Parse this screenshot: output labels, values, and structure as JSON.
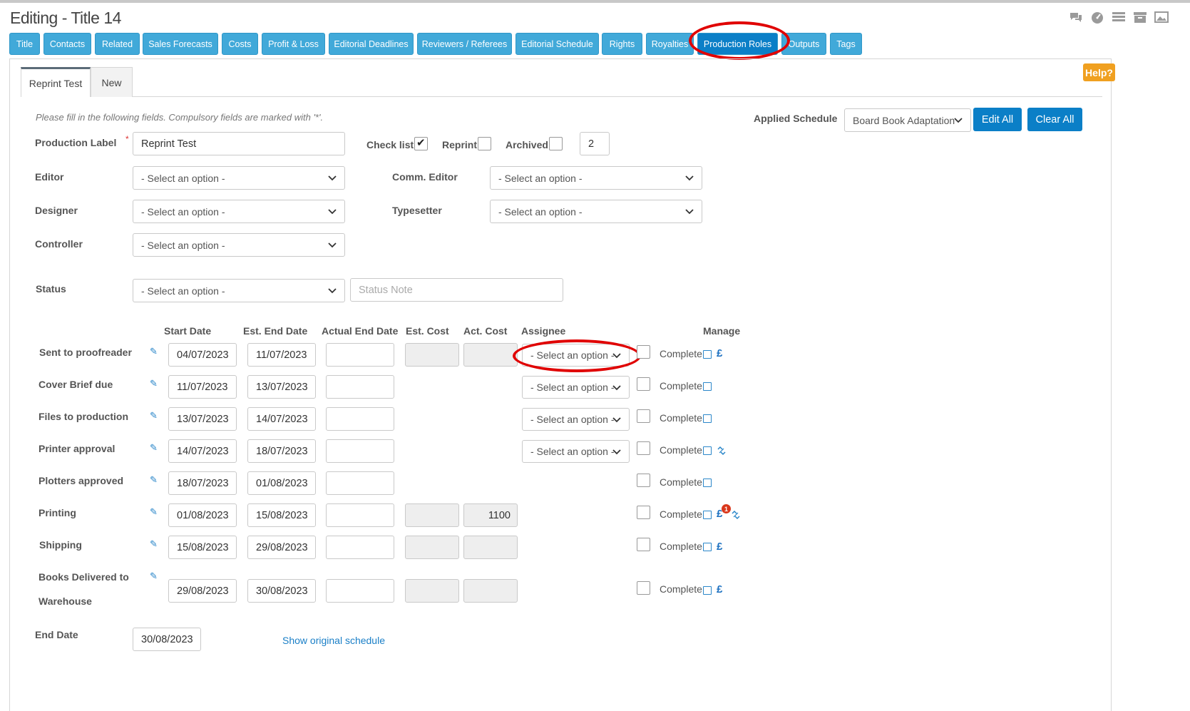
{
  "window": {
    "title": "Editing - Title 14"
  },
  "top_icons": [
    "comments-icon",
    "dashboard-icon",
    "list-icon",
    "archive-icon",
    "image-icon"
  ],
  "tabs": [
    {
      "label": "Title",
      "active": false
    },
    {
      "label": "Contacts",
      "active": false
    },
    {
      "label": "Related",
      "active": false
    },
    {
      "label": "Sales Forecasts",
      "active": false
    },
    {
      "label": "Costs",
      "active": false
    },
    {
      "label": "Profit & Loss",
      "active": false
    },
    {
      "label": "Editorial Deadlines",
      "active": false
    },
    {
      "label": "Reviewers / Referees",
      "active": false
    },
    {
      "label": "Editorial Schedule",
      "active": false
    },
    {
      "label": "Rights",
      "active": false
    },
    {
      "label": "Royalties",
      "active": false
    },
    {
      "label": "Production Roles",
      "active": true
    },
    {
      "label": "Outputs",
      "active": false
    },
    {
      "label": "Tags",
      "active": false
    }
  ],
  "help_label": "Help?",
  "subtabs": [
    {
      "label": "Reprint Test",
      "active": true
    },
    {
      "label": "New",
      "active": false
    }
  ],
  "form": {
    "hint": "Please fill in the following fields. Compulsory fields are marked with '*'.",
    "required_mark": "*",
    "production_label": {
      "label": "Production Label",
      "value": "Reprint Test"
    },
    "check_list": {
      "label": "Check list",
      "checked": true
    },
    "reprint": {
      "label": "Reprint",
      "checked": false
    },
    "archived": {
      "label": "Archived",
      "checked": false
    },
    "number_value": "2",
    "applied_schedule": {
      "label": "Applied Schedule",
      "value": "Board Book Adaptation"
    },
    "edit_all_label": "Edit All",
    "clear_all_label": "Clear All",
    "editor": {
      "label": "Editor",
      "value": "- Select an option -"
    },
    "comm_editor": {
      "label": "Comm. Editor",
      "value": "- Select an option -"
    },
    "designer": {
      "label": "Designer",
      "value": "- Select an option -"
    },
    "typesetter": {
      "label": "Typesetter",
      "value": "- Select an option -"
    },
    "controller": {
      "label": "Controller",
      "value": "- Select an option -"
    },
    "status": {
      "label": "Status",
      "value": "- Select an option -",
      "note_placeholder": "Status Note"
    }
  },
  "schedule": {
    "headers": {
      "start": "Start Date",
      "est_end": "Est. End Date",
      "actual_end": "Actual End Date",
      "est_cost": "Est. Cost",
      "act_cost": "Act. Cost",
      "assignee": "Assignee",
      "manage": "Manage"
    },
    "complete_label": "Complete",
    "assignee_placeholder": "- Select an option -",
    "pound_symbol": "£",
    "badge_count": "1",
    "rows": [
      {
        "name": "Sent to proofreader",
        "name2": "",
        "start": "04/07/2023",
        "est_end": "11/07/2023",
        "actual_end": "",
        "act_cost": ""
      },
      {
        "name": "Cover Brief due",
        "name2": "",
        "start": "11/07/2023",
        "est_end": "13/07/2023",
        "actual_end": "",
        "act_cost": ""
      },
      {
        "name": "Files to production",
        "name2": "",
        "start": "13/07/2023",
        "est_end": "14/07/2023",
        "actual_end": "",
        "act_cost": ""
      },
      {
        "name": "Printer approval",
        "name2": "",
        "start": "14/07/2023",
        "est_end": "18/07/2023",
        "actual_end": "",
        "act_cost": ""
      },
      {
        "name": "Plotters approved",
        "name2": "",
        "start": "18/07/2023",
        "est_end": "01/08/2023",
        "actual_end": "",
        "act_cost": ""
      },
      {
        "name": "Printing",
        "name2": "",
        "start": "01/08/2023",
        "est_end": "15/08/2023",
        "actual_end": "",
        "act_cost": "1100"
      },
      {
        "name": "Shipping",
        "name2": "",
        "start": "15/08/2023",
        "est_end": "29/08/2023",
        "actual_end": "",
        "act_cost": ""
      },
      {
        "name": "Books Delivered to",
        "name2": "Warehouse",
        "start": "29/08/2023",
        "est_end": "30/08/2023",
        "actual_end": "",
        "act_cost": ""
      }
    ]
  },
  "end_date": {
    "label": "End Date",
    "value": "30/08/2023"
  },
  "show_original_label": "Show original schedule",
  "colors": {
    "tab": "#41a9d9",
    "tab_active": "#0b7fc7",
    "help": "#f0a020",
    "highlight": "#e00000"
  }
}
